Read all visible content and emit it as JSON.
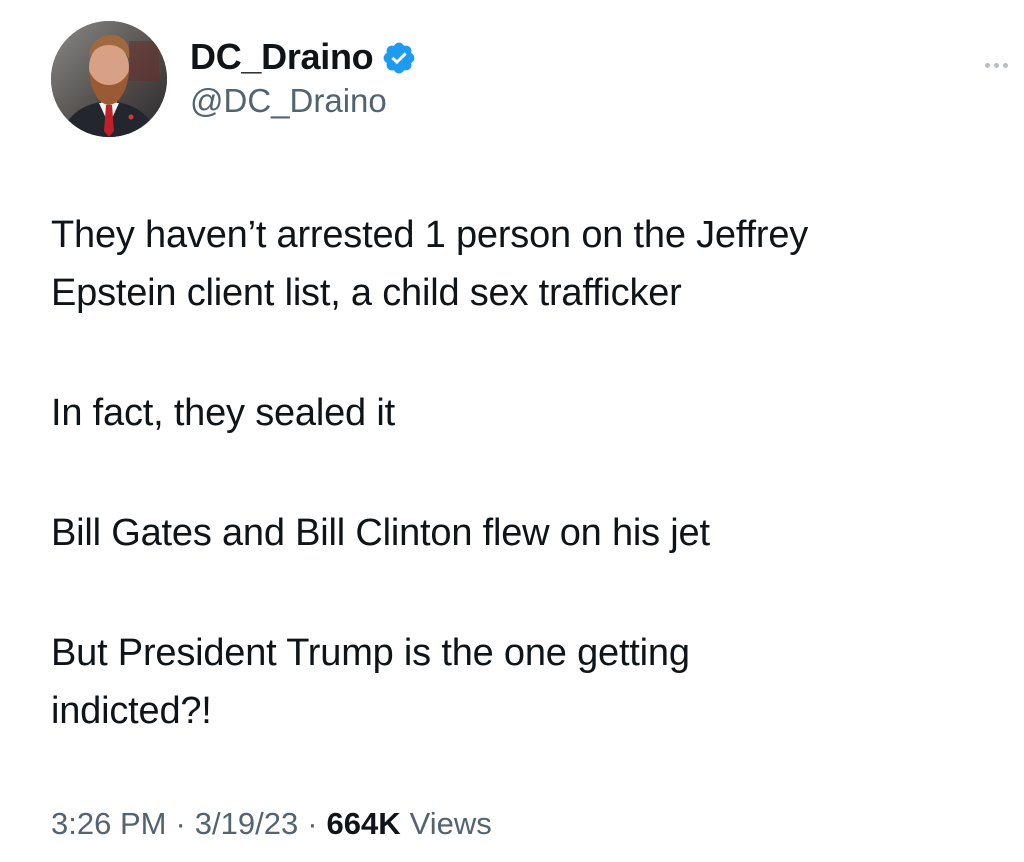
{
  "author": {
    "display_name": "DC_Draino",
    "handle": "@DC_Draino",
    "verified_icon": "verified-badge-icon",
    "verified_color": "#1d9bf0"
  },
  "menu": {
    "icon": "more-horizontal-icon"
  },
  "tweet": {
    "paragraphs": [
      {
        "lines": [
          "They haven’t arrested 1 person on the Jeffrey",
          "Epstein client list, a child sex trafficker"
        ]
      },
      {
        "lines": [
          "In fact, they sealed it"
        ]
      },
      {
        "lines": [
          "Bill Gates and Bill Clinton flew on his jet"
        ]
      },
      {
        "lines": [
          "But President Trump is the one getting",
          "indicted?!"
        ]
      }
    ]
  },
  "meta": {
    "time": "3:26 PM",
    "separator": "·",
    "date": "3/19/23",
    "views_count": "664K",
    "views_label": "Views"
  },
  "colors": {
    "text_primary": "#0f1419",
    "text_secondary": "#536471",
    "background": "#ffffff"
  }
}
